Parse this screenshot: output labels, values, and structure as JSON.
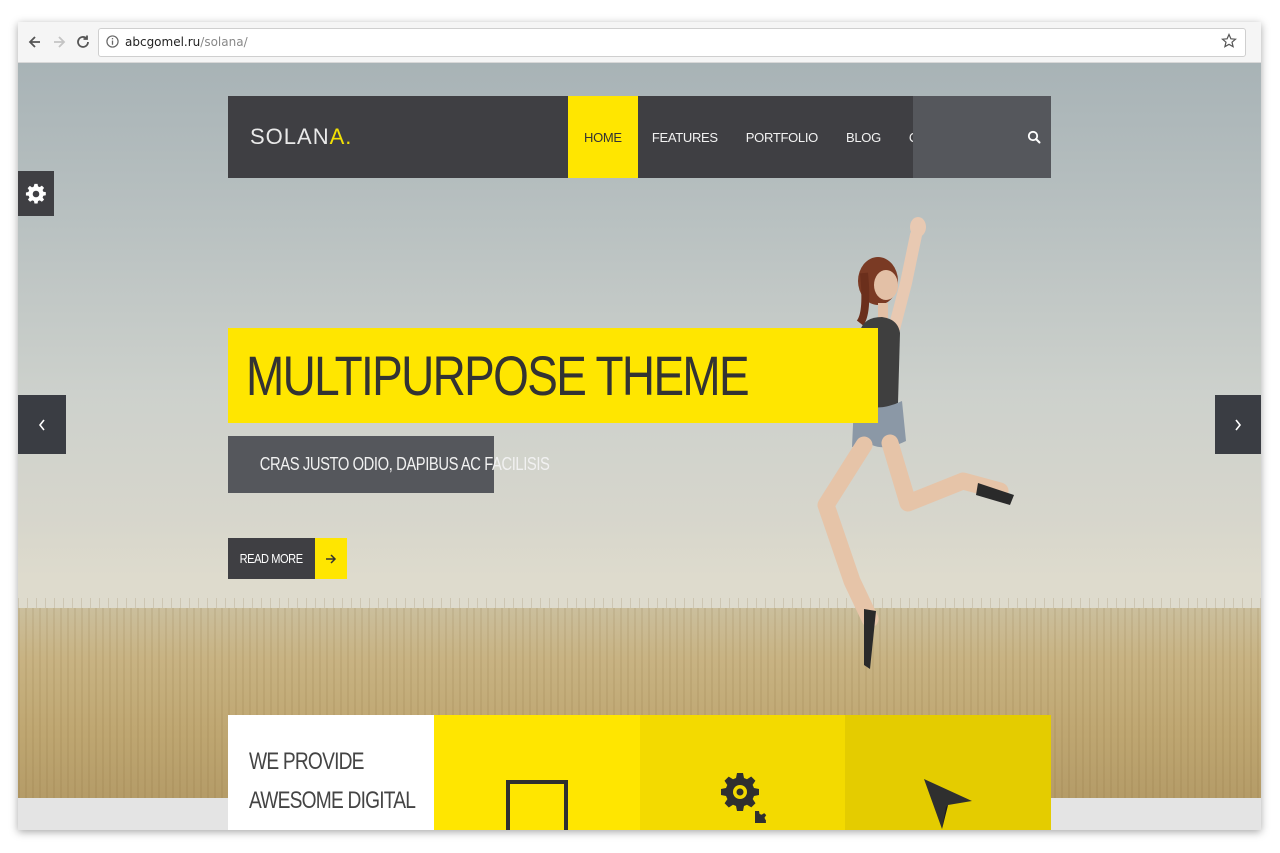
{
  "browser": {
    "url_host": "abcgomel.ru",
    "url_path": "/solana/"
  },
  "header": {
    "logo_text": "SOLAN",
    "logo_accent": "A.",
    "menu": [
      {
        "label": "HOME",
        "active": true
      },
      {
        "label": "FEATURES",
        "active": false
      },
      {
        "label": "PORTFOLIO",
        "active": false
      },
      {
        "label": "BLOG",
        "active": false
      },
      {
        "label": "CONTACT",
        "active": false
      }
    ]
  },
  "hero": {
    "title": "MULTIPURPOSE THEME",
    "subtitle": "CRAS JUSTO ODIO, DAPIBUS AC FACILISIS",
    "cta_label": "READ MORE"
  },
  "services": {
    "intro_line1": "WE PROVIDE",
    "intro_line2": "AWESOME DIGITAL"
  },
  "colors": {
    "accent": "#ffe600",
    "dark": "#3f3f43",
    "mid_gray": "#55575c"
  }
}
